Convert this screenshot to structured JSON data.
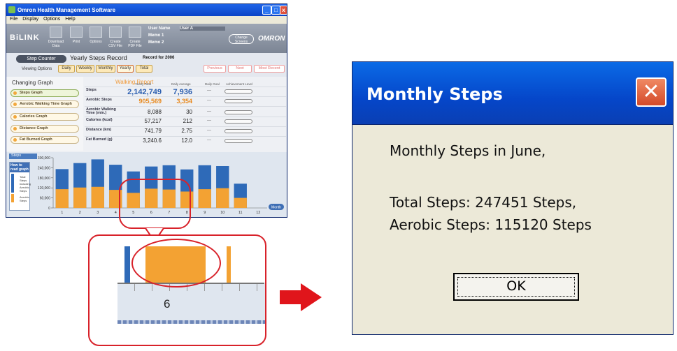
{
  "app": {
    "title": "Omron Health Management Software",
    "menu": [
      "File",
      "Display",
      "Options",
      "Help"
    ],
    "logo": "BiLINK",
    "brand": "OMRON",
    "tools": [
      "Download Data",
      "Print",
      "Options",
      "Create CSV File",
      "Create PDF File"
    ],
    "user": {
      "name_label": "User Name",
      "name_value": "User A",
      "memo1": "Memo 1",
      "memo2": "Memo 2"
    },
    "change_screens": "Change Screens"
  },
  "tabs": {
    "step_counter": "Step Counter",
    "record_title": "Yearly Steps Record",
    "record_for": "Record for 2006",
    "viewing_options": "Viewing Options",
    "view_tabs": [
      "Daily",
      "Weekly",
      "Monthly",
      "Yearly",
      "Total"
    ],
    "nav": [
      "Previous",
      "Next",
      "Most Recent"
    ]
  },
  "left_panel": {
    "header": "Changing Graph",
    "buttons": [
      "Steps Graph",
      "Aerobic Walking Time Graph",
      "Calories Graph",
      "Distance Graph",
      "Fat Burned Graph"
    ]
  },
  "report": {
    "title": "Walking Report",
    "columns": [
      "Yearly Total",
      "Daily Average",
      "Daily Goal",
      "Achievement Level"
    ],
    "rows": [
      {
        "label": "Steps",
        "yearly": "2,142,749",
        "daily": "7,936",
        "goal": "---"
      },
      {
        "label": "Aerobic Steps",
        "yearly": "905,569",
        "daily": "3,354",
        "goal": "---"
      },
      {
        "label": "Aerobic Walking Time (min.)",
        "yearly": "8,088",
        "daily": "30",
        "goal": "---"
      },
      {
        "label": "Calories (kcal)",
        "yearly": "57,217",
        "daily": "212",
        "goal": "---"
      },
      {
        "label": "Distance (km)",
        "yearly": "741.79",
        "daily": "2.75",
        "goal": "---"
      },
      {
        "label": "Fat Burned (g)",
        "yearly": "3,240.6",
        "daily": "12.0",
        "goal": "---"
      }
    ]
  },
  "graph": {
    "label": "Steps",
    "howto_title": "How to read graph",
    "howto_total": "Total Steps including Aerobic Steps",
    "howto_aerobic": "Aerobic Steps",
    "month_button": "Month"
  },
  "chart_data": {
    "type": "bar",
    "categories": [
      "1",
      "2",
      "3",
      "4",
      "5",
      "6",
      "7",
      "8",
      "9",
      "10",
      "11",
      "12"
    ],
    "series": [
      {
        "name": "Total Steps",
        "values": [
          232000,
          268000,
          290000,
          258000,
          218000,
          247451,
          255000,
          230000,
          255000,
          250000,
          145000,
          0
        ]
      },
      {
        "name": "Aerobic Steps",
        "values": [
          112000,
          122000,
          126000,
          108000,
          90000,
          115120,
          110000,
          98000,
          112000,
          118000,
          60000,
          0
        ]
      }
    ],
    "ylim": [
      0,
      300000
    ],
    "yticks": [
      "0",
      "60,000",
      "120,000",
      "180,000",
      "240,000",
      "300,000"
    ],
    "colors": {
      "total": "#2e6ab8",
      "aerobic": "#f3a233"
    }
  },
  "zoom": {
    "label": "6"
  },
  "dialog": {
    "title": "Monthly Steps",
    "line1": "Monthly Steps in June,",
    "line2": "Total Steps: 247451 Steps,",
    "line3": "Aerobic Steps: 115120 Steps",
    "ok": "OK",
    "close_glyph": "✕"
  }
}
